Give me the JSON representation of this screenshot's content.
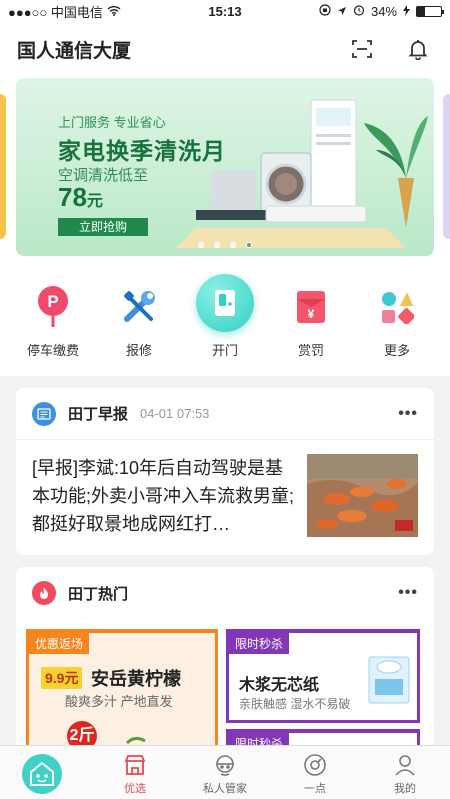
{
  "status_bar": {
    "carrier": "●●●○○ 中国电信",
    "time": "15:13",
    "battery": "34%",
    "battery_level": 0.34
  },
  "header": {
    "title": "国人通信大厦"
  },
  "banner": {
    "tagline": "上门服务 专业省心",
    "headline": "家电换季清洗月",
    "subline": "空调清洗低至",
    "price": "78",
    "price_unit": "元",
    "cta": "立即抢购",
    "page_count": 4,
    "active_page": 3
  },
  "quick_actions": [
    {
      "label": "停车缴费",
      "icon": "parking-icon"
    },
    {
      "label": "报修",
      "icon": "repair-tools-icon"
    },
    {
      "label": "开门",
      "icon": "door-open-icon"
    },
    {
      "label": "赏罚",
      "icon": "reward-envelope-icon"
    },
    {
      "label": "更多",
      "icon": "more-apps-icon"
    }
  ],
  "news_card": {
    "title": "田丁早报",
    "time": "04-01 07:53",
    "more": "•••",
    "headline": "[早报]李斌:10年后自动驾驶是基本功能;外卖小哥冲入车流救男童;都挺好取景地成网红打…",
    "icon": "newspaper-icon"
  },
  "hot_card": {
    "title": "田丁热门",
    "more": "•••",
    "icon": "flame-icon",
    "deal": {
      "tag": "优惠返场",
      "price_tag": "9.9元",
      "title": "安岳黄柠檬",
      "subtitle": "酸爽多汁 产地直发",
      "badge": "2斤"
    },
    "flash1": {
      "tag": "限时秒杀",
      "title": "木浆无芯纸",
      "subtitle": "亲肤触感 湿水不易破"
    },
    "flash2": {
      "tag": "限时秒杀"
    }
  },
  "tabbar": [
    {
      "label": "",
      "icon": "home-mascot-icon"
    },
    {
      "label": "优选",
      "icon": "shop-icon"
    },
    {
      "label": "私人管家",
      "icon": "butler-icon"
    },
    {
      "label": "一点",
      "icon": "dot-circle-icon"
    },
    {
      "label": "我的",
      "icon": "person-icon"
    }
  ],
  "colors": {
    "accent": "#3fd1c6",
    "banner_green": "#17723e",
    "deal_orange": "#f5861e",
    "flash_purple": "#8236b8"
  }
}
